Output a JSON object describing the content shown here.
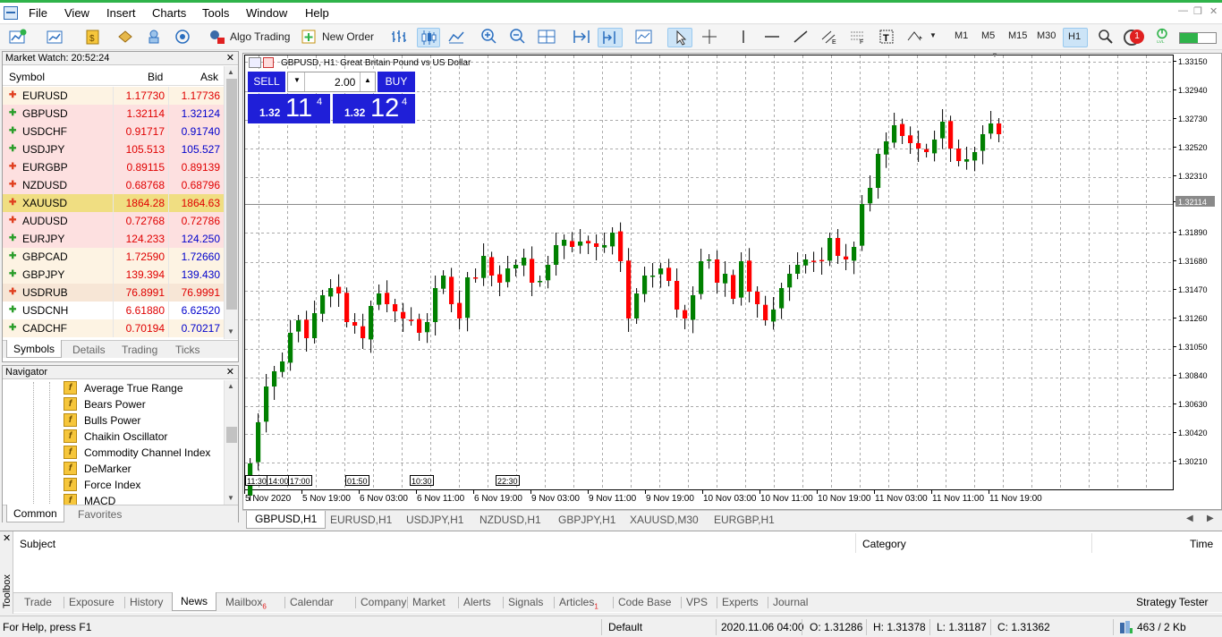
{
  "menu": [
    "File",
    "View",
    "Insert",
    "Charts",
    "Tools",
    "Window",
    "Help"
  ],
  "toolbar": {
    "algo_trading": "Algo Trading",
    "new_order": "New Order",
    "timeframes": [
      "M1",
      "M5",
      "M15",
      "M30",
      "H1"
    ],
    "active_timeframe": "H1",
    "notification_count": "1"
  },
  "market_watch": {
    "title": "Market Watch: 20:52:24",
    "columns": {
      "symbol": "Symbol",
      "bid": "Bid",
      "ask": "Ask"
    },
    "rows": [
      {
        "symbol": "EURUSD",
        "bid": "1.17730",
        "ask": "1.17736",
        "dir": "down"
      },
      {
        "symbol": "GBPUSD",
        "bid": "1.32114",
        "ask": "1.32124",
        "dir": "up"
      },
      {
        "symbol": "USDCHF",
        "bid": "0.91717",
        "ask": "0.91740",
        "dir": "up"
      },
      {
        "symbol": "USDJPY",
        "bid": "105.513",
        "ask": "105.527",
        "dir": "up"
      },
      {
        "symbol": "EURGBP",
        "bid": "0.89115",
        "ask": "0.89139",
        "dir": "down"
      },
      {
        "symbol": "NZDUSD",
        "bid": "0.68768",
        "ask": "0.68796",
        "dir": "down"
      },
      {
        "symbol": "XAUUSD",
        "bid": "1864.28",
        "ask": "1864.63",
        "dir": "down"
      },
      {
        "symbol": "AUDUSD",
        "bid": "0.72768",
        "ask": "0.72786",
        "dir": "down"
      },
      {
        "symbol": "EURJPY",
        "bid": "124.233",
        "ask": "124.250",
        "dir": "up"
      },
      {
        "symbol": "GBPCAD",
        "bid": "1.72590",
        "ask": "1.72660",
        "dir": "up"
      },
      {
        "symbol": "GBPJPY",
        "bid": "139.394",
        "ask": "139.430",
        "dir": "up"
      },
      {
        "symbol": "USDRUB",
        "bid": "76.8991",
        "ask": "76.9991",
        "dir": "down"
      },
      {
        "symbol": "USDCNH",
        "bid": "6.61880",
        "ask": "6.62520",
        "dir": "up"
      },
      {
        "symbol": "CADCHF",
        "bid": "0.70194",
        "ask": "0.70217",
        "dir": "up"
      }
    ],
    "tabs": [
      "Symbols",
      "Details",
      "Trading",
      "Ticks"
    ]
  },
  "navigator": {
    "title": "Navigator",
    "items": [
      "Average True Range",
      "Bears Power",
      "Bulls Power",
      "Chaikin Oscillator",
      "Commodity Channel Index",
      "DeMarker",
      "Force Index",
      "MACD"
    ],
    "tabs": [
      "Common",
      "Favorites"
    ]
  },
  "chart": {
    "title": "GBPUSD, H1:  Great Britain Pound vs US Dollar",
    "sell": "SELL",
    "buy": "BUY",
    "lot": "2.00",
    "sell_price": {
      "prefix": "1.32",
      "big": "11",
      "sup": "4"
    },
    "buy_price": {
      "prefix": "1.32",
      "big": "12",
      "sup": "4"
    },
    "price_labels": [
      "1.33150",
      "1.32940",
      "1.32730",
      "1.32520",
      "1.32310",
      "1.32114",
      "1.31890",
      "1.31680",
      "1.31470",
      "1.31260",
      "1.31050",
      "1.30840",
      "1.30630",
      "1.30420",
      "1.30210"
    ],
    "time_labels": [
      "5 Nov 2020",
      "5 Nov 19:00",
      "6 Nov 03:00",
      "6 Nov 11:00",
      "6 Nov 19:00",
      "9 Nov 03:00",
      "9 Nov 11:00",
      "9 Nov 19:00",
      "10 Nov 03:00",
      "10 Nov 11:00",
      "10 Nov 19:00",
      "11 Nov 03:00",
      "11 Nov 11:00",
      "11 Nov 19:00"
    ],
    "session_labels": [
      "11:30",
      "14:00",
      "17:00",
      "01:50",
      "10:30",
      "22:30"
    ],
    "tabs": [
      "GBPUSD,H1",
      "EURUSD,H1",
      "USDJPY,H1",
      "NZDUSD,H1",
      "GBPJPY,H1",
      "XAUUSD,M30",
      "EURGBP,H1"
    ]
  },
  "toolbox": {
    "side_label": "Toolbox",
    "columns": {
      "subject": "Subject",
      "category": "Category",
      "time": "Time"
    },
    "tabs": [
      "Trade",
      "Exposure",
      "History",
      "News",
      "Mailbox",
      "Calendar",
      "Company",
      "Market",
      "Alerts",
      "Signals",
      "Articles",
      "Code Base",
      "VPS",
      "Experts",
      "Journal"
    ],
    "mailbox_badge": "6",
    "articles_badge": "1",
    "strategy_tester": "Strategy Tester"
  },
  "status": {
    "help": "For Help, press F1",
    "profile": "Default",
    "datetime": "2020.11.06 04:00",
    "open": "O: 1.31286",
    "high": "H: 1.31378",
    "low": "L: 1.31187",
    "close": "C: 1.31362",
    "traffic": "463 / 2 Kb"
  },
  "colors": {
    "up_candle": "#008000",
    "down_candle": "#ff0000",
    "trade_panel": "#1f1fd8",
    "bid_text": "#e00000",
    "ask_text": "#0000cc"
  }
}
